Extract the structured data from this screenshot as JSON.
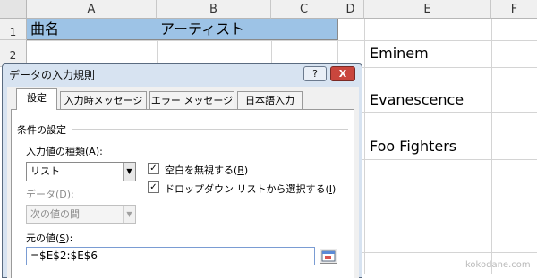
{
  "sheet": {
    "columns": [
      "A",
      "B",
      "C",
      "D",
      "E",
      "F"
    ],
    "rows": [
      "1",
      "2"
    ],
    "header_cells": [
      "曲名",
      "アーティスト"
    ],
    "artists": [
      "Eminem",
      "Evanescence",
      "Foo Fighters"
    ]
  },
  "dialog": {
    "title": "データの入力規則",
    "help_button": "?",
    "close_button": "X",
    "tabs": [
      "設定",
      "入力時メッセージ",
      "エラー メッセージ",
      "日本語入力"
    ],
    "group_label": "条件の設定",
    "allow": {
      "label_prefix": "入力値の種類(",
      "label_key": "A",
      "label_suffix": "):",
      "value": "リスト"
    },
    "ignore_blank": {
      "label_prefix": "空白を無視する(",
      "label_key": "B",
      "label_suffix": ")",
      "checked": "✓"
    },
    "in_cell_dropdown": {
      "label_prefix": "ドロップダウン リストから選択する(",
      "label_key": "I",
      "label_suffix": ")",
      "checked": "✓"
    },
    "data": {
      "label": "データ(D):",
      "value": "次の値の間"
    },
    "source": {
      "label_prefix": "元の値(",
      "label_key": "S",
      "label_suffix": "):",
      "value": "=$E$2:$E$6"
    }
  },
  "watermark": "kokodane.com",
  "colors": {
    "header_fill": "#9dc3e6",
    "dialog_frame": "#d7e3f1",
    "close_button": "#c9463d"
  }
}
